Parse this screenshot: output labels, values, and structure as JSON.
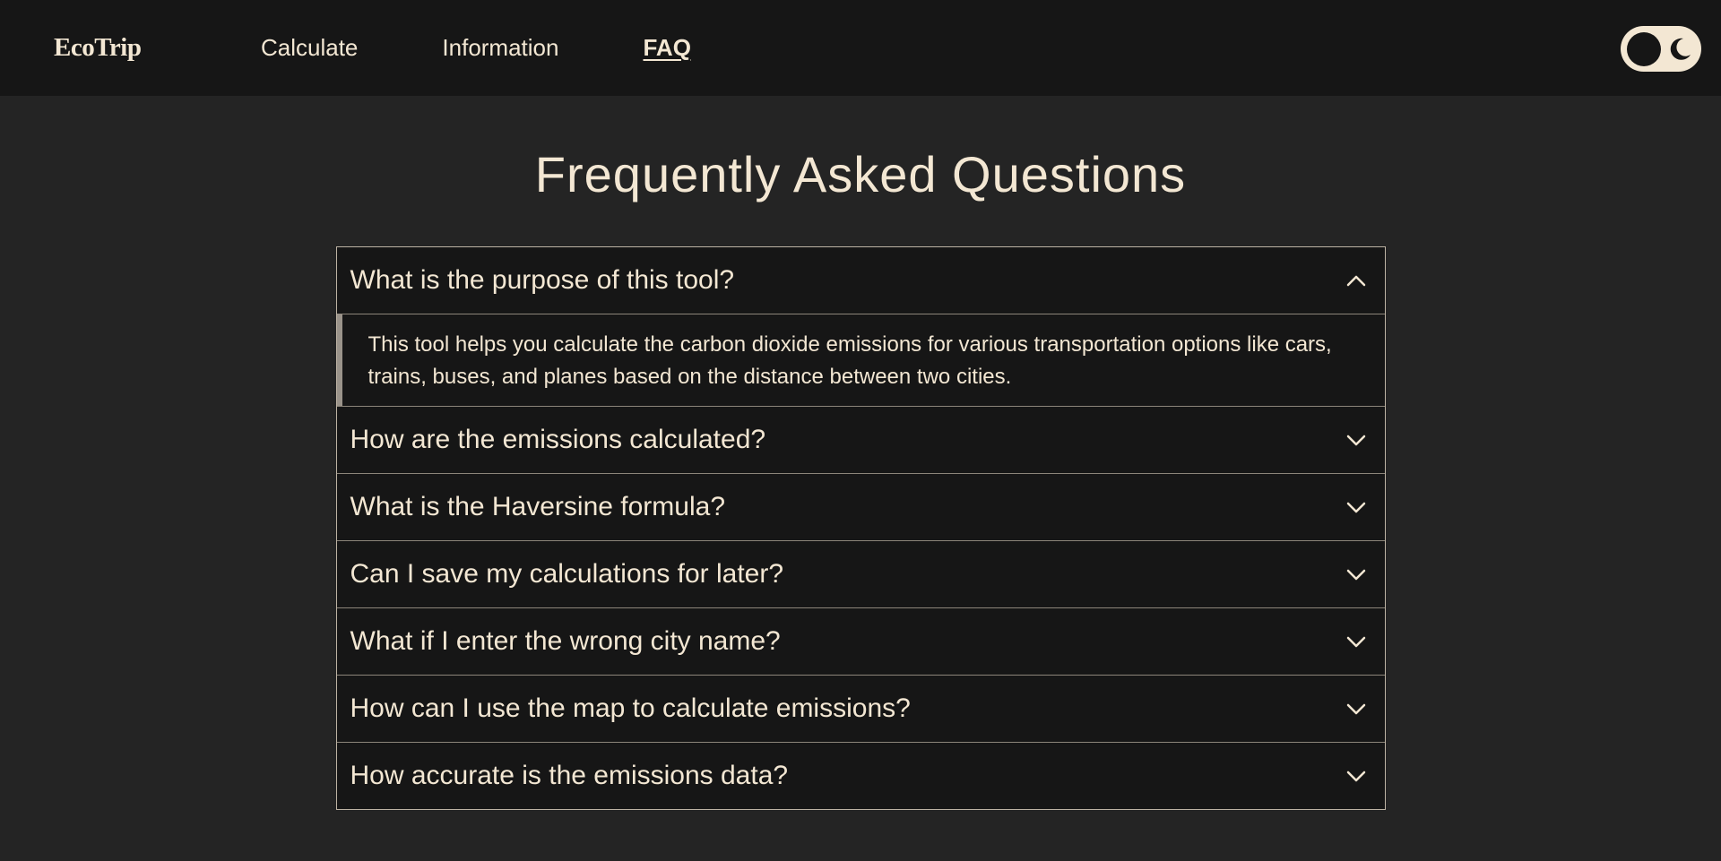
{
  "brand": "EcoTrip",
  "nav": {
    "links": [
      {
        "label": "Calculate"
      },
      {
        "label": "Information"
      },
      {
        "label": "FAQ",
        "active": true
      }
    ]
  },
  "theme_toggle": {
    "icon": "moon-icon",
    "state": "dark"
  },
  "page_title": "Frequently Asked Questions",
  "faq": [
    {
      "question": "What is the purpose of this tool?",
      "answer": "This tool helps you calculate the carbon dioxide emissions for various transportation options like cars, trains, buses, and planes based on the distance between two cities.",
      "expanded": true
    },
    {
      "question": "How are the emissions calculated?",
      "expanded": false
    },
    {
      "question": "What is the Haversine formula?",
      "expanded": false
    },
    {
      "question": "Can I save my calculations for later?",
      "expanded": false
    },
    {
      "question": "What if I enter the wrong city name?",
      "expanded": false
    },
    {
      "question": "How can I use the map to calculate emissions?",
      "expanded": false
    },
    {
      "question": "How accurate is the emissions data?",
      "expanded": false
    }
  ],
  "colors": {
    "background": "#242424",
    "navbar": "#161616",
    "text": "#f3e7d3",
    "border": "#bdb3a4"
  }
}
